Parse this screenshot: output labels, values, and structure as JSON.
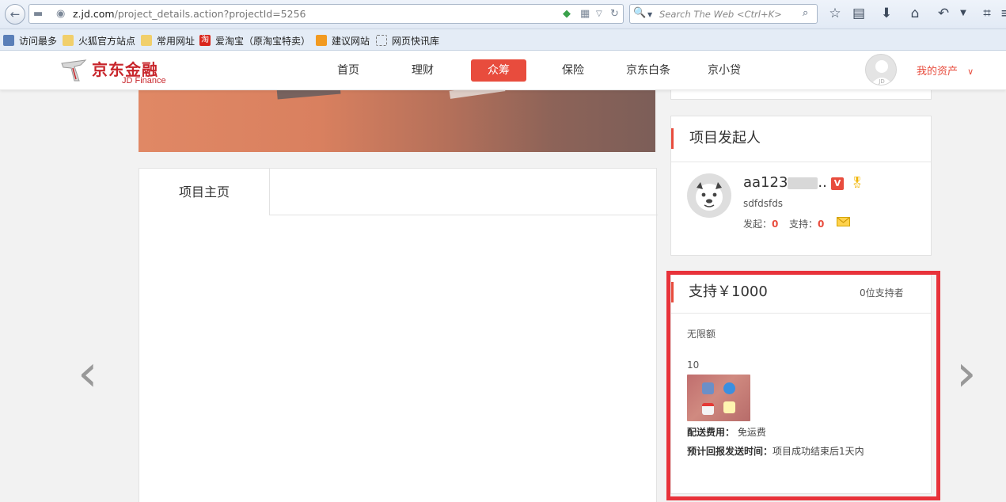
{
  "browser": {
    "url_host": "z.jd.com",
    "url_path": "/project_details.action?projectId=5256",
    "search_placeholder": "Search The Web <Ctrl+K>",
    "bookmarks": [
      "访问最多",
      "火狐官方站点",
      "常用网址",
      "爱淘宝（原淘宝特卖）",
      "建议网站",
      "网页快讯库"
    ]
  },
  "site": {
    "logo_cn": "京东金融",
    "logo_en": "JD Finance",
    "nav": [
      "首页",
      "理财",
      "众筹",
      "保险",
      "京东白条",
      "京小贷"
    ],
    "active_nav": "众筹",
    "my_assets": "我的资产",
    "avatar_label": "JD"
  },
  "project": {
    "tab_home": "项目主页"
  },
  "sponsor": {
    "title": "项目发起人",
    "name": "aa123",
    "name_suffix": "..",
    "subtitle": "sdfdsfds",
    "launched_label": "发起：",
    "launched_value": "0",
    "supported_label": "支持：",
    "supported_value": "0"
  },
  "reward": {
    "title": "支持￥1000",
    "supporters": "0位支持者",
    "limit": "无限额",
    "quantity": "10",
    "shipping_label": "配送费用：",
    "shipping_value": "免运费",
    "delivery_label": "预计回报发送时间：",
    "delivery_value": "项目成功结束后1天内"
  },
  "colors": {
    "accent": "#e84c3d",
    "highlight_border": "#e8323a"
  },
  "icons": {
    "prev": "chevron-left-icon",
    "next": "chevron-right-icon",
    "mail": "mail-icon",
    "verified": "v-badge-icon",
    "medal": "medal-icon"
  }
}
